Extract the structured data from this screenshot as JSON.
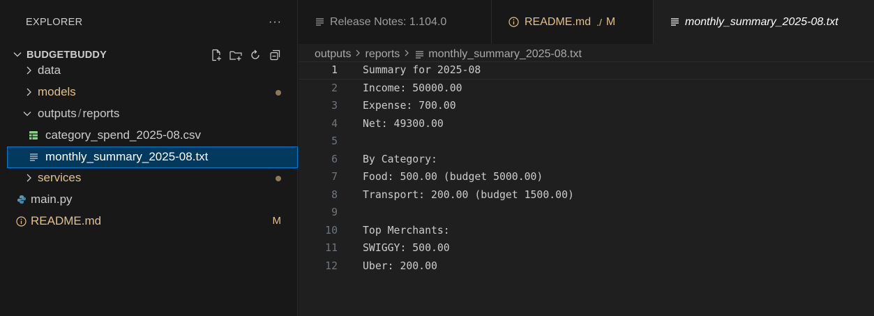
{
  "sidebar": {
    "title": "EXPLORER",
    "more": "···",
    "project": {
      "name": "BUDGETBUDDY"
    },
    "items": [
      {
        "label": "data",
        "type": "folder",
        "expanded": false
      },
      {
        "label": "models",
        "type": "folder",
        "expanded": false,
        "status": "modified"
      },
      {
        "label": "outputs",
        "sep": "/",
        "label2": "reports",
        "type": "folder",
        "expanded": true
      },
      {
        "label": "category_spend_2025-08.csv",
        "type": "csv-file"
      },
      {
        "label": "monthly_summary_2025-08.txt",
        "type": "text-file",
        "selected": true
      },
      {
        "label": "services",
        "type": "folder",
        "expanded": false,
        "status": "modified"
      },
      {
        "label": "main.py",
        "type": "python-file"
      },
      {
        "label": "README.md",
        "type": "info-file",
        "badge": "M"
      }
    ]
  },
  "tabs": [
    {
      "label": "Release Notes: 1.104.0",
      "icon": "lines-icon"
    },
    {
      "label": "README.md",
      "path": "./",
      "badge": "M",
      "icon": "info-icon"
    },
    {
      "label": "monthly_summary_2025-08.txt",
      "icon": "lines-icon",
      "active": true
    }
  ],
  "breadcrumb": [
    "outputs",
    "reports",
    "monthly_summary_2025-08.txt"
  ],
  "code": {
    "lines": [
      "Summary for 2025-08",
      "Income: 50000.00",
      "Expense: 700.00",
      "Net: 49300.00",
      "",
      "By Category:",
      "Food: 500.00 (budget 5000.00)",
      "Transport: 200.00 (budget 1500.00)",
      "",
      "Top Merchants:",
      "SWIGGY: 500.00",
      "Uber: 200.00"
    ],
    "line_numbers": [
      "1",
      "2",
      "3",
      "4",
      "5",
      "6",
      "7",
      "8",
      "9",
      "10",
      "11",
      "12"
    ],
    "active_line": 1
  },
  "colors": {
    "background": "#181818",
    "editor_background": "#1f1f1f",
    "selection": "#04395e",
    "focus_border": "#0078d4",
    "modified": "#e2c08d",
    "csv_green": "#89d185",
    "python_blue": "#519aba"
  }
}
